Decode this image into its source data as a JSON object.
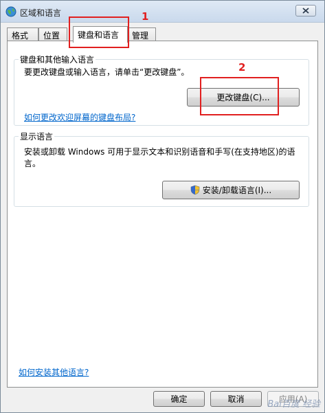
{
  "window": {
    "title": "区域和语言"
  },
  "tabs": [
    {
      "label": "格式"
    },
    {
      "label": "位置"
    },
    {
      "label": "键盘和语言"
    },
    {
      "label": "管理"
    }
  ],
  "keyboard_group": {
    "title": "键盘和其他输入语言",
    "description": "要更改键盘或输入语言，请单击“更改键盘”。",
    "button_label": "更改键盘(C)...",
    "link": "如何更改欢迎屏幕的键盘布局?"
  },
  "display_group": {
    "title": "显示语言",
    "description": "安装或卸载 Windows 可用于显示文本和识别语音和手写(在支持地区)的语言。",
    "button_label": "安装/卸载语言(I)..."
  },
  "footer_link": "如何安装其他语言?",
  "buttons": {
    "ok": "确定",
    "cancel": "取消",
    "apply": "应用(A)"
  },
  "annotations": {
    "one": "1",
    "two": "2"
  },
  "watermark": "Bai百度 经验",
  "colors": {
    "annotation": "#e11f1f",
    "link": "#0066cc"
  }
}
